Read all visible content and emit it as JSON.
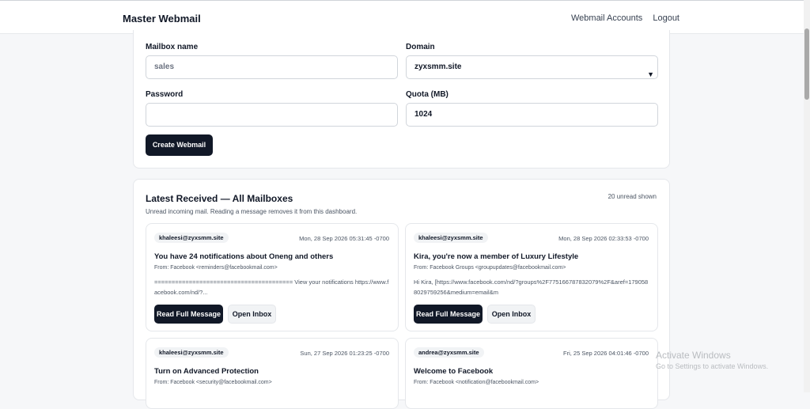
{
  "header": {
    "brand": "Master Webmail",
    "nav": [
      "Webmail Accounts",
      "Logout"
    ]
  },
  "form": {
    "mailbox_label": "Mailbox name",
    "mailbox_placeholder": "sales",
    "domain_label": "Domain",
    "domain_value": "zyxsmm.site",
    "password_label": "Password",
    "password_value": "",
    "quota_label": "Quota (MB)",
    "quota_value": "1024",
    "create_button": "Create Webmail"
  },
  "latest": {
    "title": "Latest Received — All Mailboxes",
    "subtitle": "Unread incoming mail. Reading a message removes it from this dashboard.",
    "unread_count": "20 unread shown",
    "read_button": "Read Full Message",
    "inbox_button": "Open Inbox",
    "mails": [
      {
        "mailbox": "khaleesi@zyxsmm.site",
        "date": "Mon, 28 Sep 2026 05:31:45 -0700",
        "subject": "You have 24 notifications about Oneng and others",
        "from": "From: Facebook <reminders@facebookmail.com>",
        "snippet": "======================================== View your notifications https://www.facebook.com/nd/?..."
      },
      {
        "mailbox": "khaleesi@zyxsmm.site",
        "date": "Mon, 28 Sep 2026 02:33:53 -0700",
        "subject": "Kira, you're now a member of Luxury Lifestyle",
        "from": "From: Facebook Groups <groupupdates@facebookmail.com>",
        "snippet": "Hi Kira, [https://www.facebook.com/nd/?groups%2F775166787832079%2F&aref=1790588029759256&medium=email&m"
      },
      {
        "mailbox": "khaleesi@zyxsmm.site",
        "date": "Sun, 27 Sep 2026 01:23:25 -0700",
        "subject": "Turn on Advanced Protection",
        "from": "From: Facebook <security@facebookmail.com>",
        "snippet": ""
      },
      {
        "mailbox": "andrea@zyxsmm.site",
        "date": "Fri, 25 Sep 2026 04:01:46 -0700",
        "subject": "Welcome to Facebook",
        "from": "From: Facebook <notification@facebookmail.com>",
        "snippet": ""
      }
    ]
  },
  "watermark": {
    "line1": "Activate Windows",
    "line2": "Go to Settings to activate Windows."
  }
}
